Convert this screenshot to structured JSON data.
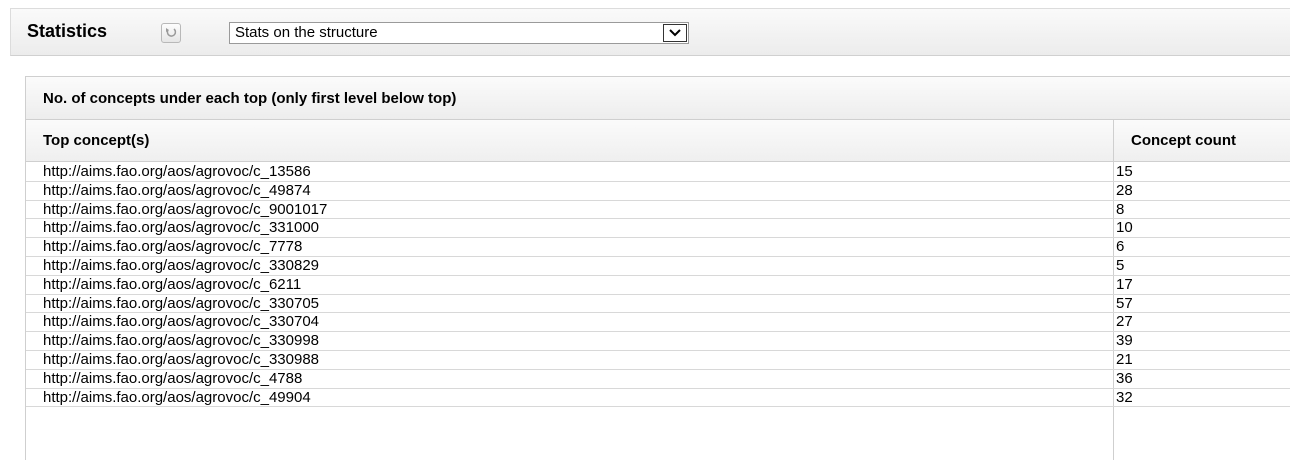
{
  "toolbar": {
    "title": "Statistics",
    "select_value": "Stats on the structure"
  },
  "panel": {
    "heading": "No. of concepts under each top (only first level below top)",
    "columns": [
      "Top concept(s)",
      "Concept count"
    ],
    "rows": [
      {
        "concept": "http://aims.fao.org/aos/agrovoc/c_13586",
        "count": "15"
      },
      {
        "concept": "http://aims.fao.org/aos/agrovoc/c_49874",
        "count": "28"
      },
      {
        "concept": "http://aims.fao.org/aos/agrovoc/c_9001017",
        "count": "8"
      },
      {
        "concept": "http://aims.fao.org/aos/agrovoc/c_331000",
        "count": "10"
      },
      {
        "concept": "http://aims.fao.org/aos/agrovoc/c_7778",
        "count": "6"
      },
      {
        "concept": "http://aims.fao.org/aos/agrovoc/c_330829",
        "count": "5"
      },
      {
        "concept": "http://aims.fao.org/aos/agrovoc/c_6211",
        "count": "17"
      },
      {
        "concept": "http://aims.fao.org/aos/agrovoc/c_330705",
        "count": "57"
      },
      {
        "concept": "http://aims.fao.org/aos/agrovoc/c_330704",
        "count": "27"
      },
      {
        "concept": "http://aims.fao.org/aos/agrovoc/c_330998",
        "count": "39"
      },
      {
        "concept": "http://aims.fao.org/aos/agrovoc/c_330988",
        "count": "21"
      },
      {
        "concept": "http://aims.fao.org/aos/agrovoc/c_4788",
        "count": "36"
      },
      {
        "concept": "http://aims.fao.org/aos/agrovoc/c_49904",
        "count": "32"
      }
    ]
  }
}
